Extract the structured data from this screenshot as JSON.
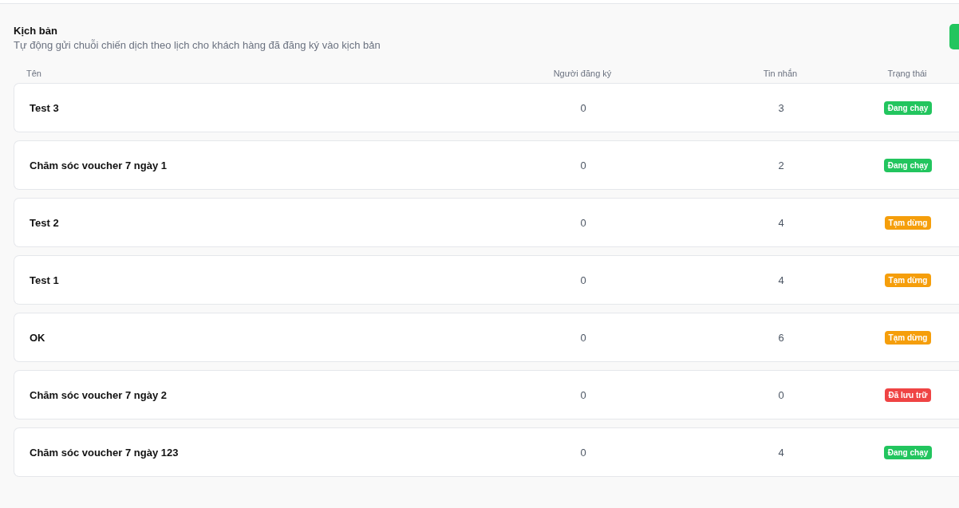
{
  "header": {
    "title": "Kịch bản",
    "subtitle": "Tự động gửi chuỗi chiến dịch theo lịch cho khách hàng đã đăng ký vào kịch bản"
  },
  "table": {
    "columns": [
      "Tên",
      "Người đăng ký",
      "Tin nhắn",
      "Trạng thái"
    ],
    "rows": [
      {
        "name": "Test 3",
        "subscribers": "0",
        "messages": "3",
        "status": "Đang chạy",
        "color": "#22c55e"
      },
      {
        "name": "Chăm sóc voucher 7 ngày 1",
        "subscribers": "0",
        "messages": "2",
        "status": "Đang chạy",
        "color": "#22c55e"
      },
      {
        "name": "Test 2",
        "subscribers": "0",
        "messages": "4",
        "status": "Tạm dừng",
        "color": "#f59e0b"
      },
      {
        "name": "Test 1",
        "subscribers": "0",
        "messages": "4",
        "status": "Tạm dừng",
        "color": "#f59e0b"
      },
      {
        "name": "OK",
        "subscribers": "0",
        "messages": "6",
        "status": "Tạm dừng",
        "color": "#f59e0b"
      },
      {
        "name": "Chăm sóc voucher 7 ngày 2",
        "subscribers": "0",
        "messages": "0",
        "status": "Đã lưu trữ",
        "color": "#ef4444"
      },
      {
        "name": "Chăm sóc voucher 7 ngày 123",
        "subscribers": "0",
        "messages": "4",
        "status": "Đang chạy",
        "color": "#22c55e"
      }
    ]
  }
}
